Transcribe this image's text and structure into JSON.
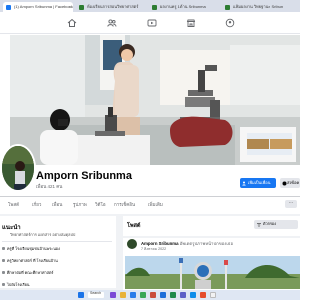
{
  "browser": {
    "tabs": [
      {
        "label": "(1) Amporn Sribunma | Facebook",
        "color": "#1877f2",
        "active": true
      },
      {
        "label": "ห้องเรียนการสอนวิทยาศาสตร์",
        "color": "#2e7d32",
        "active": false
      },
      {
        "label": "ผลงานครู 1ด้าน Sribunma",
        "color": "#2e7d32",
        "active": false
      },
      {
        "label": "แฟ้มผลงาน วิทยฐานะ Sribun",
        "color": "#2e7d32",
        "active": false
      }
    ]
  },
  "profile": {
    "name": "Amporn Sribunma",
    "friends": "เพื่อน 421 คน",
    "add_friend_label": "เพิ่มเป็นเพื่อน",
    "message_label": "ส่งข้อค"
  },
  "profile_tabs": [
    "โพสต์",
    "เกี่ยว",
    "เพื่อน",
    "รูปภาพ",
    "วิดีโอ",
    "การเช็คอิน",
    "เพิ่มเติม"
  ],
  "more_button": "···",
  "intro": {
    "title": "แนะนำ",
    "bio": "วิทยาศาสตร์การ แยกสาร อย่างสมดุลปป",
    "lines": [
      "ครูที่ โรงเรียนชุมชนบ้านพระนอง",
      "ครูวิทยาศาสตร์ ที่ โรงเรียนบ้าน",
      "ศึกษาต่อที่ คณะศึกษาศาสตร์",
      "ไปยังโรงเรียน"
    ]
  },
  "posts": {
    "title": "โพสต์",
    "filter_label": "ตัวกรอง"
  },
  "post": {
    "author": "Amporn Sribunma",
    "action": "อัพเดตรูปภาพหน้าปกของเธอ",
    "date": "7 สิงหาคม 2022"
  },
  "taskbar": {
    "search_label": "Search"
  },
  "colors": {
    "facebook_blue": "#1877f2",
    "page_bg": "#f0f2f5"
  }
}
